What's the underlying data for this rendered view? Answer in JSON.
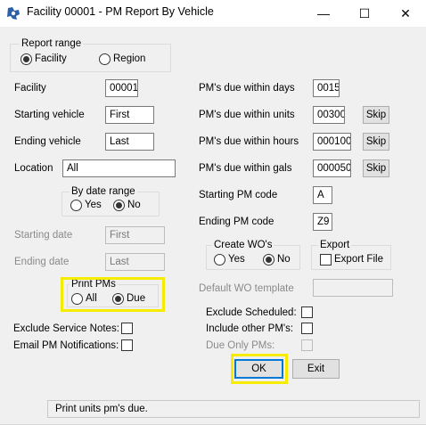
{
  "window": {
    "title": "Facility 00001 - PM Report By Vehicle",
    "minimize": "—",
    "maximize": "☐",
    "close": "✕"
  },
  "report_range": {
    "legend": "Report range",
    "facility": "Facility",
    "region": "Region",
    "selected": "Facility"
  },
  "left": {
    "facility_label": "Facility",
    "facility_value": "00001",
    "starting_vehicle_label": "Starting vehicle",
    "starting_vehicle_value": "First",
    "ending_vehicle_label": "Ending vehicle",
    "ending_vehicle_value": "Last",
    "location_label": "Location",
    "location_value": "All",
    "by_date_range": {
      "legend": "By date range",
      "yes": "Yes",
      "no": "No",
      "selected": "No"
    },
    "starting_date_label": "Starting date",
    "starting_date_value": "First",
    "ending_date_label": "Ending date",
    "ending_date_value": "Last",
    "print_pms": {
      "legend": "Print PMs",
      "all": "All",
      "due": "Due",
      "selected": "Due"
    },
    "exclude_service_notes_label": "Exclude Service Notes:",
    "email_pm_notifications_label": "Email PM Notifications:"
  },
  "right": {
    "days_label": "PM's due within days",
    "days_value": "0015",
    "units_label": "PM's due within units",
    "units_value": "00300",
    "hours_label": "PM's due within hours",
    "hours_value": "000100",
    "gals_label": "PM's due within gals",
    "gals_value": "000050",
    "skip_label": "Skip",
    "starting_pm_code_label": "Starting PM code",
    "starting_pm_code_value": "A",
    "ending_pm_code_label": "Ending PM code",
    "ending_pm_code_value": "Z9",
    "create_wos": {
      "legend": "Create WO's",
      "yes": "Yes",
      "no": "No",
      "selected": "No"
    },
    "export": {
      "legend": "Export",
      "export_file": "Export File"
    },
    "default_wo_template_label": "Default WO template",
    "default_wo_template_value": "",
    "exclude_scheduled_label": "Exclude Scheduled:",
    "include_other_pms_label": "Include other PM's:",
    "due_only_pms_label": "Due Only PMs:"
  },
  "buttons": {
    "ok": "OK",
    "exit": "Exit"
  },
  "status_text": "Print units pm's due.",
  "colors": {
    "highlight": "#f5ec00",
    "focus_blue": "#0078d7"
  }
}
